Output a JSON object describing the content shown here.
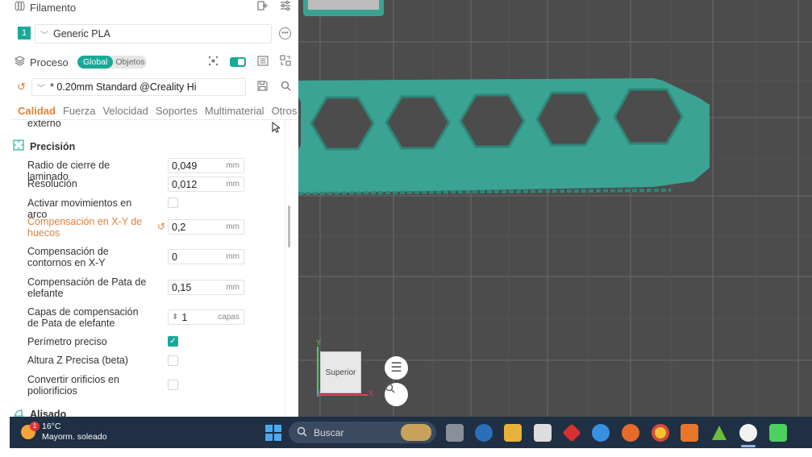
{
  "filament": {
    "title": "Filamento",
    "slot": "1",
    "selected": "Generic PLA"
  },
  "process": {
    "title": "Proceso",
    "toggle_global": "Global",
    "toggle_objects": "Objetos",
    "preset": "* 0.20mm Standard @Creality Hi"
  },
  "tabs": [
    "Calidad",
    "Fuerza",
    "Velocidad",
    "Soportes",
    "Multimaterial",
    "Otros"
  ],
  "active_tab": "Calidad",
  "settings": {
    "partial_label": "externo",
    "section_precision": "Precisión",
    "rows": [
      {
        "label": "Radio de cierre de laminado",
        "value": "0,049",
        "unit": "mm"
      },
      {
        "label": "Resolución",
        "value": "0,012",
        "unit": "mm"
      },
      {
        "label": "Activar movimientos en arco"
      },
      {
        "label": "Compensación en X-Y de huecos",
        "value": "0,2",
        "unit": "mm"
      },
      {
        "label": "Compensación de contornos en X-Y",
        "value": "0",
        "unit": "mm"
      },
      {
        "label": "Compensación de Pata de elefante",
        "value": "0,15",
        "unit": "mm"
      },
      {
        "label": "Capas de compensación de Pata de elefante",
        "value": "1",
        "unit": "capas"
      },
      {
        "label": "Perímetro preciso"
      },
      {
        "label": "Altura Z Precisa (beta)"
      },
      {
        "label": "Convertir orificios en poliorificios"
      }
    ],
    "section_next": "Alisado"
  },
  "viewport": {
    "cube_label": "Superior",
    "axis_y": "Y",
    "axis_x": "X",
    "axis_z": "Z"
  },
  "taskbar": {
    "temperature": "16°C",
    "weather": "Mayorm. soleado",
    "notification_count": "1",
    "search": "Buscar"
  },
  "colors": {
    "accent": "#19a999",
    "modified": "#e0803a",
    "model": "#3ba393",
    "viewport_bg": "#4c4c4c",
    "taskbar_bg": "#1f2f44"
  }
}
